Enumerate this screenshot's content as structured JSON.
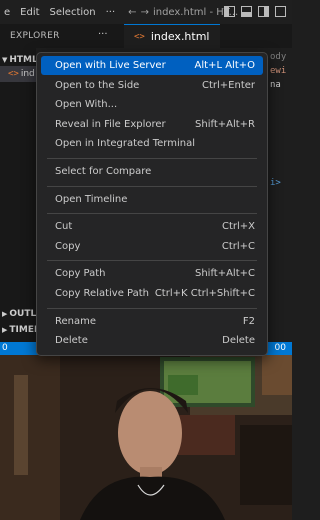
{
  "menubar": {
    "items": [
      "e",
      "Edit",
      "Selection",
      "···"
    ],
    "window_title": "index.html - HT..."
  },
  "explorer": {
    "title": "EXPLORER",
    "section_html": "HTML",
    "file_item": "ind",
    "outline": "OUTLI",
    "timeline": "TIMEL"
  },
  "tab": {
    "label": "index.html"
  },
  "editor_peek": [
    "ody",
    "ewi",
    "na",
    "i>"
  ],
  "statusbar": {
    "left": "0",
    "right": "00"
  },
  "context_menu": {
    "items": [
      {
        "label": "Open with Live Server",
        "shortcut": "Alt+L Alt+O"
      },
      {
        "label": "Open to the Side",
        "shortcut": "Ctrl+Enter"
      },
      {
        "label": "Open With...",
        "shortcut": ""
      },
      {
        "label": "Reveal in File Explorer",
        "shortcut": "Shift+Alt+R"
      },
      {
        "label": "Open in Integrated Terminal",
        "shortcut": ""
      },
      {
        "label": "Select for Compare",
        "shortcut": ""
      },
      {
        "label": "Open Timeline",
        "shortcut": ""
      },
      {
        "label": "Cut",
        "shortcut": "Ctrl+X"
      },
      {
        "label": "Copy",
        "shortcut": "Ctrl+C"
      },
      {
        "label": "Copy Path",
        "shortcut": "Shift+Alt+C"
      },
      {
        "label": "Copy Relative Path",
        "shortcut": "Ctrl+K Ctrl+Shift+C"
      },
      {
        "label": "Rename",
        "shortcut": "F2"
      },
      {
        "label": "Delete",
        "shortcut": "Delete"
      }
    ]
  },
  "colors": {
    "accent": "#0078d4",
    "menu_highlight": "#0060c0",
    "menu_bg": "#252526"
  }
}
